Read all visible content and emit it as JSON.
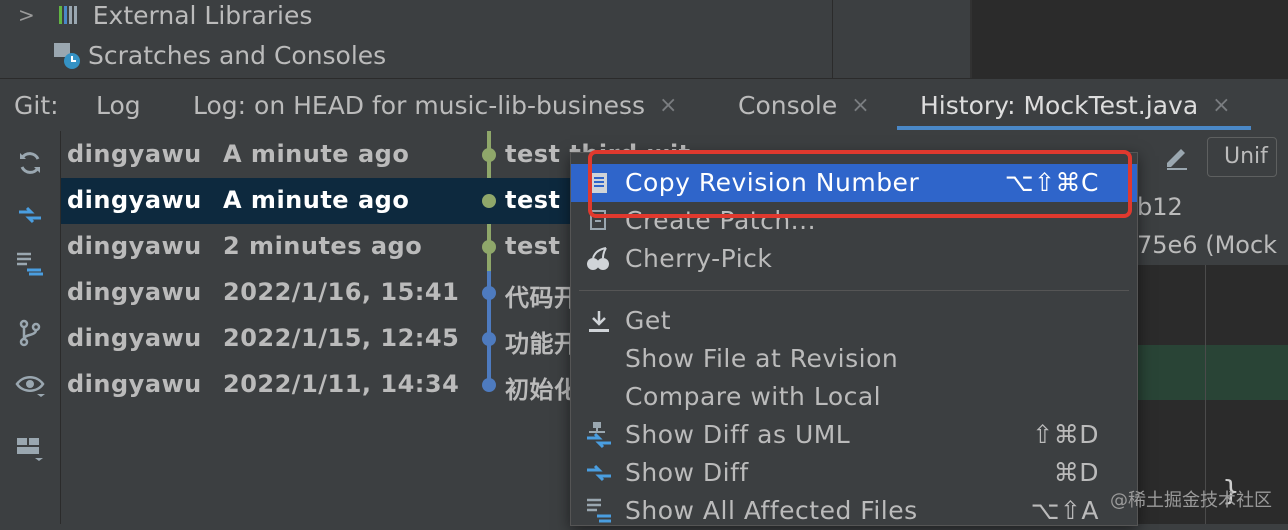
{
  "project_tree": {
    "items": [
      {
        "label": "External Libraries",
        "icon": "library-icon"
      },
      {
        "label": "Scratches and Consoles",
        "icon": "scratches-icon"
      }
    ]
  },
  "git_toolbar": {
    "prefix": "Git:",
    "tabs": [
      {
        "label": "Log",
        "closable": false
      },
      {
        "label": "Log: on HEAD for music-lib-business",
        "closable": true
      },
      {
        "label": "Console",
        "closable": true
      },
      {
        "label": "History: MockTest.java",
        "closable": true,
        "active": true
      }
    ],
    "close_glyph": "×"
  },
  "side_icons": [
    "refresh-icon",
    "compare-icon",
    "compare-list-icon",
    "branch-icon",
    "eye-icon",
    "layout-icon"
  ],
  "commits": [
    {
      "author": "dingyawu",
      "date": "A minute ago",
      "message": "test third.wit",
      "node_color": "#8fa76a",
      "selected": false
    },
    {
      "author": "dingyawu",
      "date": "A minute ago",
      "message": "test",
      "node_color": "#8fa76a",
      "selected": true
    },
    {
      "author": "dingyawu",
      "date": "2 minutes ago",
      "message": "test",
      "node_color": "#8fa76a",
      "selected": false
    },
    {
      "author": "dingyawu",
      "date": "2022/1/16, 15:41",
      "message": "代码开",
      "node_color": "#4e7bbf",
      "selected": false
    },
    {
      "author": "dingyawu",
      "date": "2022/1/15, 12:45",
      "message": "功能开",
      "node_color": "#4e7bbf",
      "selected": false
    },
    {
      "author": "dingyawu",
      "date": "2022/1/11, 14:34",
      "message": "初始化",
      "node_color": "#4e7bbf",
      "selected": false
    }
  ],
  "right_panel": {
    "button": "Unif",
    "hash1": "b12",
    "hash2": "75e6 (Mock"
  },
  "context_menu": {
    "items": [
      {
        "label": "Copy Revision Number",
        "shortcut": "⌥⇧⌘C",
        "icon": "document-icon",
        "highlighted": true
      },
      {
        "label": "Create Patch...",
        "shortcut": "",
        "icon": "patch-icon"
      },
      {
        "label": "Cherry-Pick",
        "shortcut": "",
        "icon": "cherry-icon"
      },
      {
        "label": "Get",
        "shortcut": "",
        "icon": "download-icon"
      },
      {
        "label": "Show File at Revision",
        "shortcut": "",
        "icon": ""
      },
      {
        "label": "Compare with Local",
        "shortcut": "",
        "icon": ""
      },
      {
        "label": "Show Diff as UML",
        "shortcut": "⇧⌘D",
        "icon": "uml-diff-icon"
      },
      {
        "label": "Show Diff",
        "shortcut": "⌘D",
        "icon": "diff-icon"
      },
      {
        "label": "Show All Affected Files",
        "shortcut": "⌥⇧A",
        "icon": "affected-files-icon"
      }
    ]
  },
  "watermark": "@稀土掘金技术社区",
  "colors": {
    "background": "#3c3f41",
    "editor": "#2b2b2b",
    "selection": "#0d293e",
    "menu_highlight": "#2f65ca",
    "annotation_box": "#e0392e",
    "tab_underline": "#4a88c7"
  }
}
